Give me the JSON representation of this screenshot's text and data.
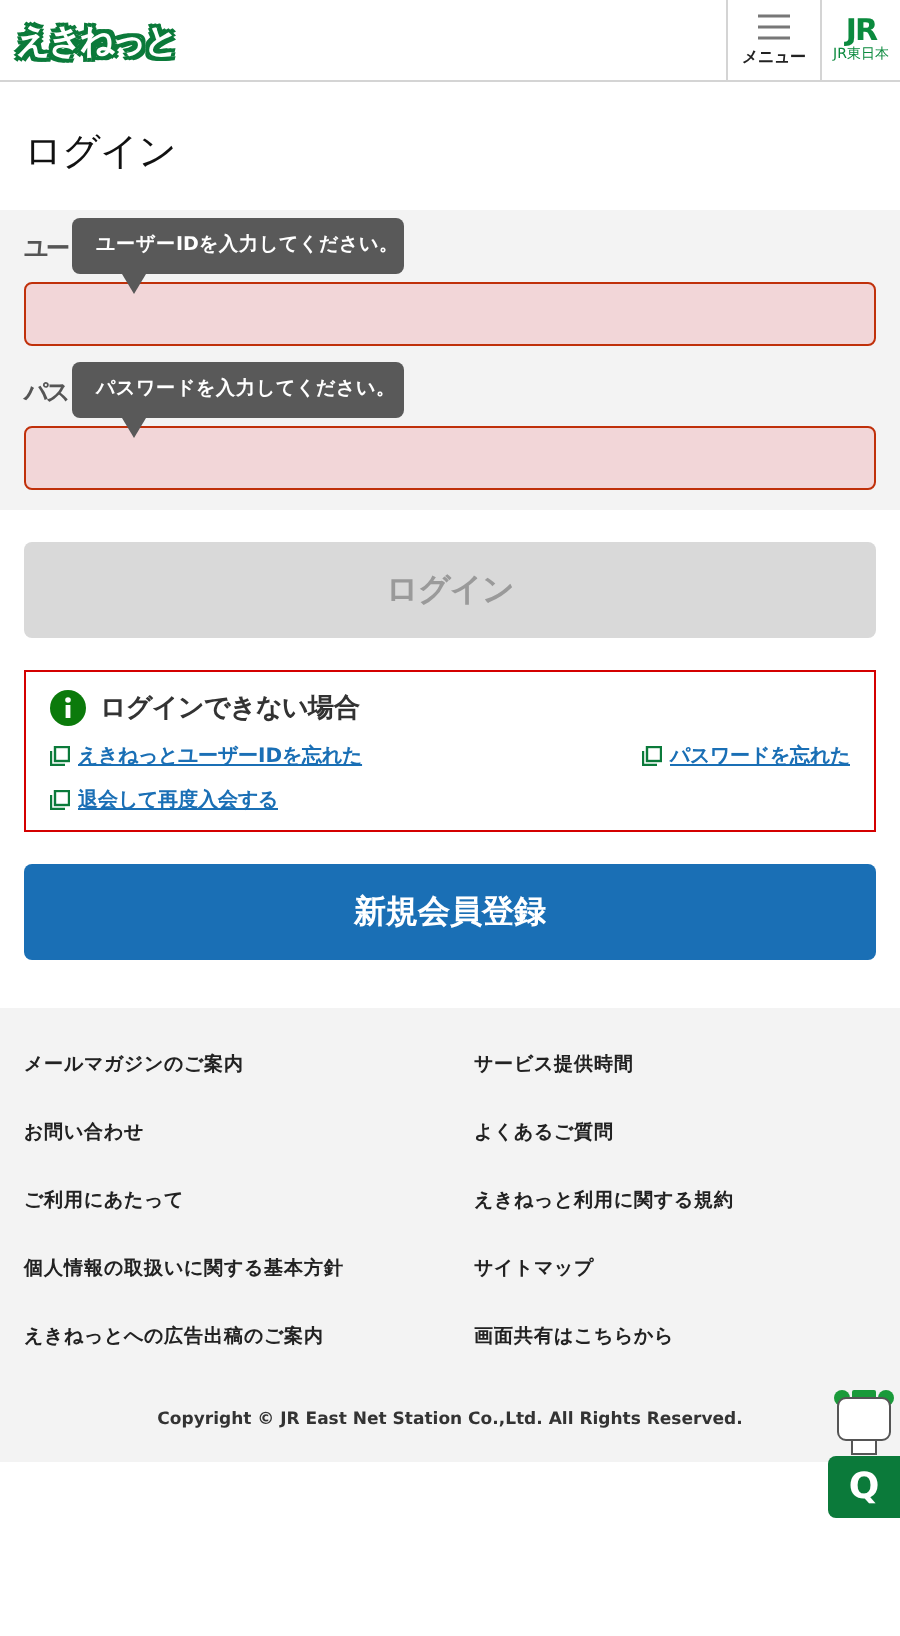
{
  "header": {
    "logo": "えきねっと",
    "menu_label": "メニュー",
    "brand": "JR",
    "brand_sub": "JR東日本"
  },
  "title": "ログイン",
  "fields": [
    {
      "label": "ユー",
      "tooltip": "ユーザーIDを入力してください。",
      "error": true
    },
    {
      "label": "パス",
      "tooltip": "パスワードを入力してください。",
      "error": true
    }
  ],
  "login_button": {
    "label": "ログイン",
    "disabled": true
  },
  "help": {
    "title": "ログインできない場合",
    "links": [
      "えきねっとユーザーIDを忘れた",
      "パスワードを忘れた",
      "退会して再度入会する"
    ]
  },
  "register_button": "新規会員登録",
  "footer_links": [
    "メールマガジンのご案内",
    "サービス提供時間",
    "お問い合わせ",
    "よくあるご質問",
    "ご利用にあたって",
    "えきねっと利用に関する規約",
    "個人情報の取扱いに関する基本方針",
    "サイトマップ",
    "えきねっとへの広告出稿のご案内",
    "画面共有はこちらから"
  ],
  "copyright": "Copyright © JR East Net Station Co.,Ltd. All Rights Reserved.",
  "chat_button": "Q"
}
